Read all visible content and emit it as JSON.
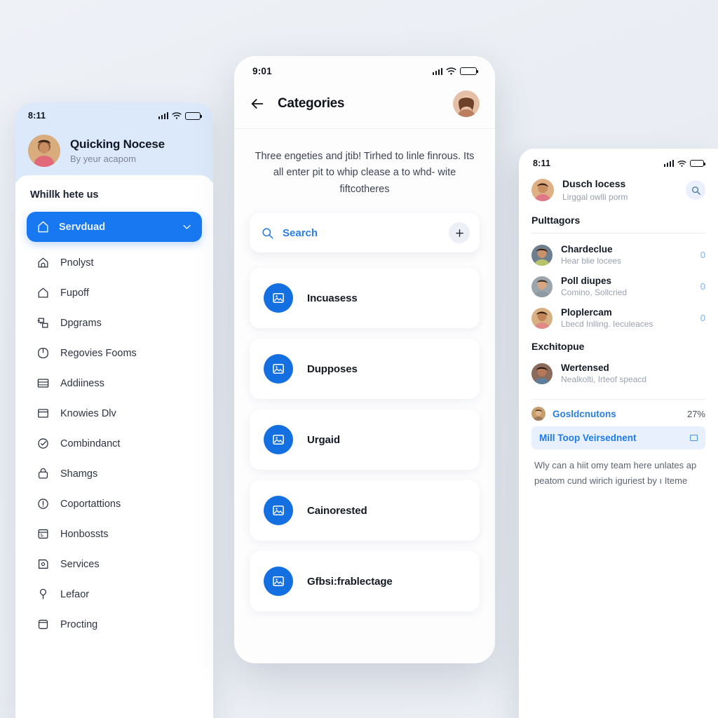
{
  "left_phone": {
    "status": {
      "time": "8:11",
      "signal_icon": "signal-bars-icon",
      "wifi_icon": "wifi-icon",
      "battery_icon": "battery-icon"
    },
    "profile": {
      "name": "Quicking Nocese",
      "subtitle": "By yeur acapom",
      "avatar": "user-avatar"
    },
    "section_title": "Whillk hete us",
    "active_item": {
      "label": "Servduad",
      "icon": "home-icon",
      "chevron": "chevron-down-icon"
    },
    "nav_items": [
      {
        "label": "Pnolyst",
        "icon": "home-alt-icon"
      },
      {
        "label": "Fupoff",
        "icon": "home-outline-icon"
      },
      {
        "label": "Dpgrams",
        "icon": "diagram-icon"
      },
      {
        "label": "Regovies Fooms",
        "icon": "clock-icon"
      },
      {
        "label": "Addiiness",
        "icon": "table-icon"
      },
      {
        "label": "Knowies Dlv",
        "icon": "window-icon"
      },
      {
        "label": "Combindanct",
        "icon": "check-circle-icon"
      },
      {
        "label": "Shamgs",
        "icon": "lock-icon"
      },
      {
        "label": "Coportattions",
        "icon": "alert-circle-icon"
      },
      {
        "label": "Honbossts",
        "icon": "calendar-icon"
      },
      {
        "label": "Services",
        "icon": "note-icon"
      },
      {
        "label": "Lefaor",
        "icon": "pin-icon"
      },
      {
        "label": "Procting",
        "icon": "archive-icon"
      }
    ]
  },
  "center_phone": {
    "status": {
      "time": "9:01",
      "signal_icon": "signal-bars-icon",
      "wifi_icon": "wifi-icon",
      "battery_icon": "battery-icon"
    },
    "header": {
      "back_icon": "arrow-left-icon",
      "title": "Categories",
      "avatar": "user-avatar"
    },
    "description": "Three engeties and jtib! Tirhed to linle finrous. Its all enter pit to whip clease a to whd- wite fiftcotheres",
    "search": {
      "icon": "search-icon",
      "label": "Search",
      "add_icon": "plus-icon"
    },
    "categories": [
      {
        "label": "Incuasess",
        "icon": "image-icon"
      },
      {
        "label": "Dupposes",
        "icon": "image-icon"
      },
      {
        "label": "Urgaid",
        "icon": "image-icon"
      },
      {
        "label": "Cainorested",
        "icon": "image-icon"
      },
      {
        "label": "Gfbsi:frablectage",
        "icon": "image-icon"
      }
    ]
  },
  "right_phone": {
    "status": {
      "time": "8:11",
      "signal_icon": "signal-bars-icon",
      "wifi_icon": "wifi-icon",
      "battery_icon": "battery-icon"
    },
    "header": {
      "name": "Dusch locess",
      "subtitle": "Lirggal owlli porm",
      "avatar": "user-avatar",
      "search_icon": "search-icon"
    },
    "groups": [
      {
        "title": "Pulttagors",
        "rows": [
          {
            "name": "Chardeclue",
            "subtitle": "Hear blie locees",
            "badge": "0",
            "avatar": "user-avatar"
          },
          {
            "name": "Poll diupes",
            "subtitle": "Comino, Sollcried",
            "badge": "0",
            "avatar": "user-avatar"
          },
          {
            "name": "Ploplercam",
            "subtitle": "Lbecd Inlling. Ieculeaces",
            "badge": "0",
            "avatar": "user-avatar"
          }
        ]
      },
      {
        "title": "Exchitopue",
        "rows": [
          {
            "name": "Wertensed",
            "subtitle": "Nealkolti, Irteof speacd",
            "badge": "",
            "avatar": "user-avatar"
          }
        ]
      }
    ],
    "footer": {
      "title": "Gosldcnutons",
      "percent": "27%",
      "avatar": "user-avatar",
      "highlight": {
        "label": "Mill Toop Veirsednent",
        "icon": "window-small-icon"
      },
      "note": "Wly can a hiit omy team here unlates ap peatom cund wirich iguriest by ı Iteme"
    }
  },
  "colors": {
    "accent_blue": "#1878f2",
    "card_blue": "#1470e0",
    "link_blue": "#2a7de1",
    "page_bg": "#eef1f6",
    "left_header_bg": "#dce9fb",
    "highlight_bg": "#e7f0fc"
  }
}
